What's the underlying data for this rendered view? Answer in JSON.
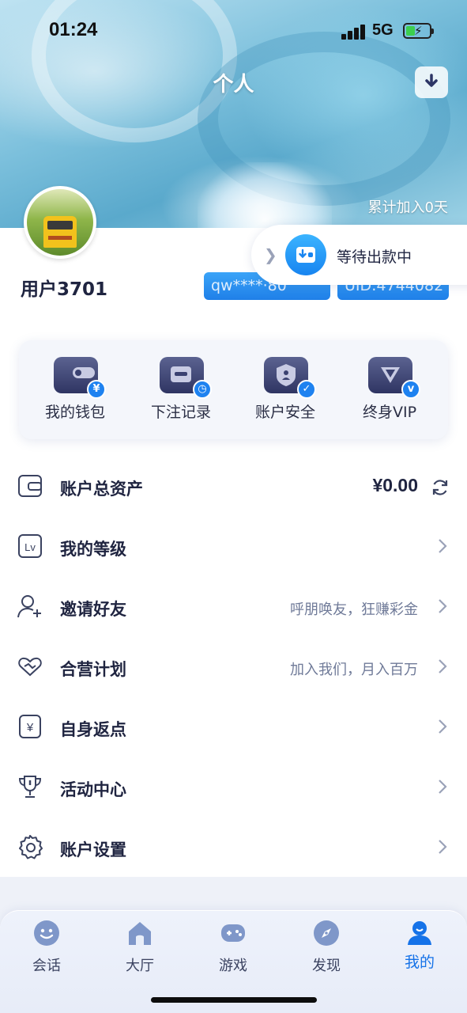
{
  "status_bar": {
    "time": "01:24",
    "network": "5G"
  },
  "header": {
    "title": "个人",
    "join_days": "累计加入0天"
  },
  "profile": {
    "username": "用户3701",
    "account_masked": "qw****·80",
    "uid": "UID:4744082"
  },
  "withdraw_popup": {
    "text": "等待出款中"
  },
  "quick_actions": [
    {
      "label": "我的钱包",
      "icon": "wallet-icon",
      "badge": "¥"
    },
    {
      "label": "下注记录",
      "icon": "bet-record-icon",
      "badge": "◷"
    },
    {
      "label": "账户安全",
      "icon": "shield-icon",
      "badge": "✓"
    },
    {
      "label": "终身VIP",
      "icon": "vip-icon",
      "badge": "v"
    }
  ],
  "menu": {
    "total_assets": {
      "label": "账户总资产",
      "amount": "¥0.00"
    },
    "items": [
      {
        "label": "我的等级",
        "hint": "",
        "icon": "level-icon"
      },
      {
        "label": "邀请好友",
        "hint": "呼朋唤友，狂赚彩金",
        "icon": "invite-user-icon"
      },
      {
        "label": "合营计划",
        "hint": "加入我们，月入百万",
        "icon": "handshake-icon"
      },
      {
        "label": "自身返点",
        "hint": "",
        "icon": "rebate-icon"
      },
      {
        "label": "活动中心",
        "hint": "",
        "icon": "trophy-icon"
      },
      {
        "label": "账户设置",
        "hint": "",
        "icon": "settings-icon"
      }
    ]
  },
  "tabbar": [
    {
      "label": "会话",
      "icon": "chat-icon",
      "active": false
    },
    {
      "label": "大厅",
      "icon": "home-icon",
      "active": false
    },
    {
      "label": "游戏",
      "icon": "gamepad-icon",
      "active": false
    },
    {
      "label": "发现",
      "icon": "compass-icon",
      "active": false
    },
    {
      "label": "我的",
      "icon": "profile-icon",
      "active": true
    }
  ],
  "colors": {
    "accent": "#1e82f0",
    "text_primary": "#1f2440",
    "text_hint": "#6f7a98"
  }
}
